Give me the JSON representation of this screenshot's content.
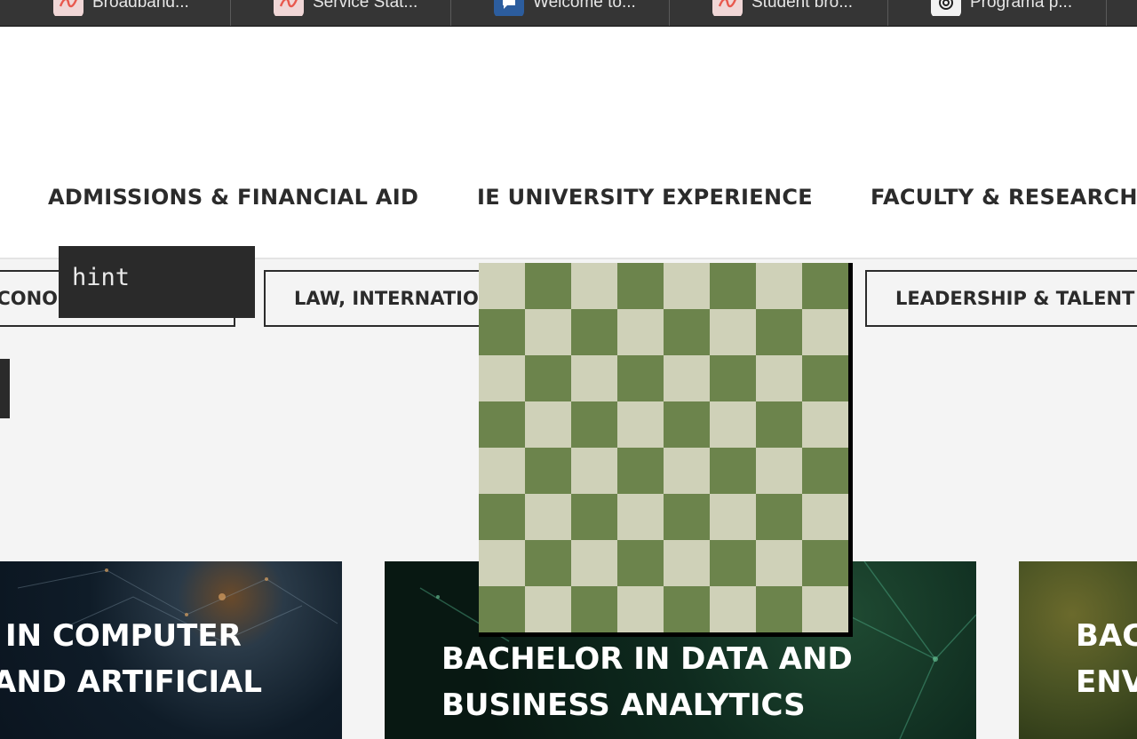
{
  "browser": {
    "tabs": [
      {
        "label": "Broadband...",
        "icon": "adobe-icon"
      },
      {
        "label": "Service Stat...",
        "icon": "adobe-icon"
      },
      {
        "label": "Welcome to...",
        "icon": "chat-bubble-icon"
      },
      {
        "label": "Student bro...",
        "icon": "adobe-icon"
      },
      {
        "label": "Programa p...",
        "icon": "openai-icon"
      }
    ]
  },
  "nav": {
    "items": [
      {
        "label": "ADMISSIONS & FINANCIAL AID"
      },
      {
        "label": "IE UNIVERSITY EXPERIENCE"
      },
      {
        "label": "FACULTY & RESEARCH"
      }
    ]
  },
  "filters": {
    "chips": [
      {
        "label": "ECONOMICS"
      },
      {
        "label": "LAW, INTERNATIONAL"
      },
      {
        "label": "LEADERSHIP & TALENT"
      }
    ]
  },
  "hint": {
    "text": "hint"
  },
  "programs": [
    {
      "line1": "IN COMPUTER",
      "line2": "AND ARTIFICIAL"
    },
    {
      "line1": "BACHELOR IN DATA AND",
      "line2": "BUSINESS ANALYTICS"
    },
    {
      "line1": "BAC",
      "line2": "ENV"
    }
  ],
  "colors": {
    "board_light": "#cfd1b8",
    "board_dark": "#6c844c",
    "tabbar": "#353535"
  }
}
